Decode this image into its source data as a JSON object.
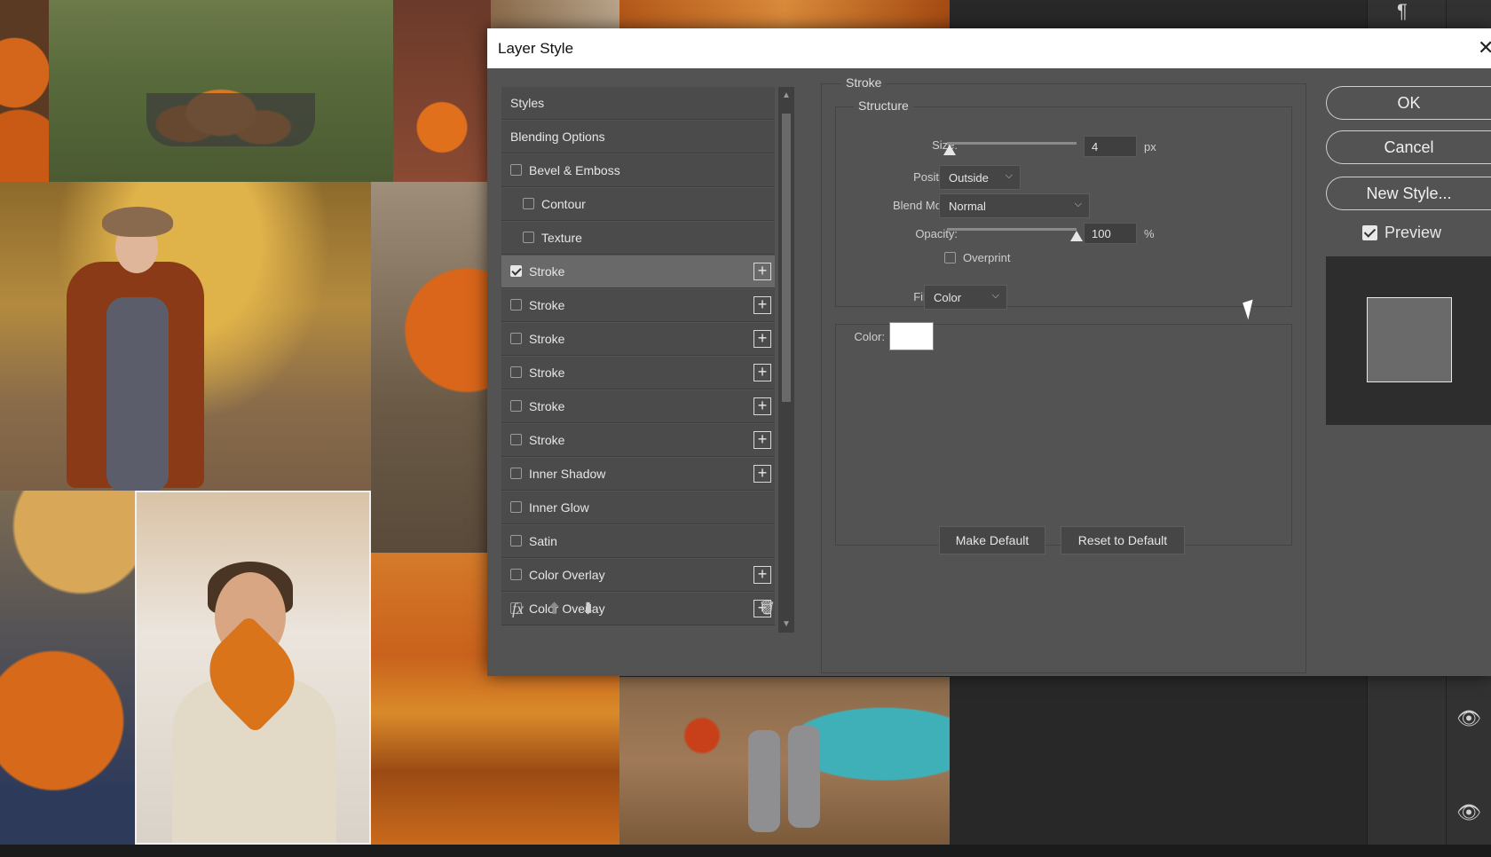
{
  "dialog": {
    "title": "Layer Style",
    "close_glyph": "✕"
  },
  "styles_list": {
    "header": "Styles",
    "blending": "Blending Options",
    "items": [
      {
        "label": "Bevel & Emboss",
        "checked": false,
        "plus": false,
        "indent": false
      },
      {
        "label": "Contour",
        "checked": false,
        "plus": false,
        "indent": true
      },
      {
        "label": "Texture",
        "checked": false,
        "plus": false,
        "indent": true
      },
      {
        "label": "Stroke",
        "checked": true,
        "plus": true,
        "indent": false,
        "selected": true
      },
      {
        "label": "Stroke",
        "checked": false,
        "plus": true,
        "indent": false
      },
      {
        "label": "Stroke",
        "checked": false,
        "plus": true,
        "indent": false
      },
      {
        "label": "Stroke",
        "checked": false,
        "plus": true,
        "indent": false
      },
      {
        "label": "Stroke",
        "checked": false,
        "plus": true,
        "indent": false
      },
      {
        "label": "Stroke",
        "checked": false,
        "plus": true,
        "indent": false
      },
      {
        "label": "Inner Shadow",
        "checked": false,
        "plus": true,
        "indent": false
      },
      {
        "label": "Inner Glow",
        "checked": false,
        "plus": false,
        "indent": false
      },
      {
        "label": "Satin",
        "checked": false,
        "plus": false,
        "indent": false
      },
      {
        "label": "Color Overlay",
        "checked": false,
        "plus": true,
        "indent": false
      },
      {
        "label": "Color Overlay",
        "checked": false,
        "plus": true,
        "indent": false
      }
    ],
    "footer_icons": {
      "fx": "fx",
      "up": "⬆",
      "down": "⬇",
      "trash": "🗑"
    }
  },
  "stroke": {
    "group_label": "Stroke",
    "structure_label": "Structure",
    "size_label": "Size:",
    "size_value": "4",
    "size_unit": "px",
    "size_slider_fraction": 0.02,
    "position_label": "Position:",
    "position_value": "Outside",
    "blend_label": "Blend Mode:",
    "blend_value": "Normal",
    "opacity_label": "Opacity:",
    "opacity_value": "100",
    "opacity_unit": "%",
    "opacity_slider_fraction": 1.0,
    "overprint_label": "Overprint",
    "fill_type_label": "Fill Type:",
    "fill_type_value": "Color",
    "color_label": "Color:",
    "color_value": "#ffffff",
    "make_default": "Make Default",
    "reset_default": "Reset to Default"
  },
  "actions": {
    "ok": "OK",
    "cancel": "Cancel",
    "new_style": "New Style...",
    "preview_label": "Preview",
    "preview_checked": true
  }
}
